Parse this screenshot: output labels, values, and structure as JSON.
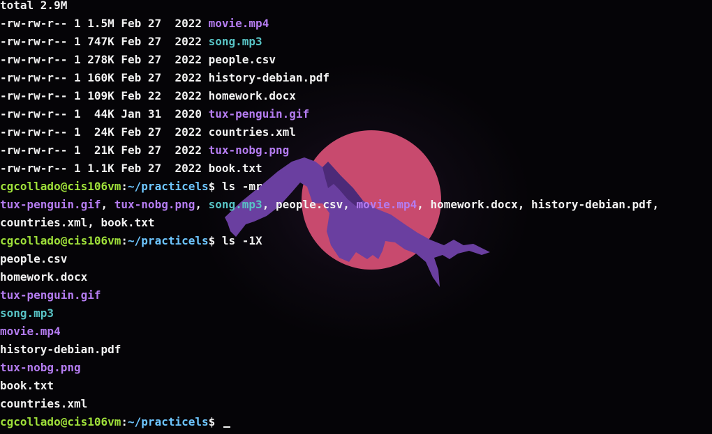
{
  "terminal": {
    "lines": [
      [
        {
          "t": "total 2.9M",
          "c": "normal"
        }
      ],
      [
        {
          "t": "-rw-rw-r-- 1 1.5M Feb 27  2022 ",
          "c": "normal"
        },
        {
          "t": "movie.mp4",
          "c": "media"
        }
      ],
      [
        {
          "t": "-rw-rw-r-- 1 747K Feb 27  2022 ",
          "c": "normal"
        },
        {
          "t": "song.mp3",
          "c": "audio"
        }
      ],
      [
        {
          "t": "-rw-rw-r-- 1 278K Feb 27  2022 ",
          "c": "normal"
        },
        {
          "t": "people.csv",
          "c": "normal"
        }
      ],
      [
        {
          "t": "-rw-rw-r-- 1 160K Feb 27  2022 ",
          "c": "normal"
        },
        {
          "t": "history-debian.pdf",
          "c": "normal"
        }
      ],
      [
        {
          "t": "-rw-rw-r-- 1 109K Feb 22  2022 ",
          "c": "normal"
        },
        {
          "t": "homework.docx",
          "c": "normal"
        }
      ],
      [
        {
          "t": "-rw-rw-r-- 1  44K Jan 31  2020 ",
          "c": "normal"
        },
        {
          "t": "tux-penguin.gif",
          "c": "media"
        }
      ],
      [
        {
          "t": "-rw-rw-r-- 1  24K Feb 27  2022 ",
          "c": "normal"
        },
        {
          "t": "countries.xml",
          "c": "normal"
        }
      ],
      [
        {
          "t": "-rw-rw-r-- 1  21K Feb 27  2022 ",
          "c": "normal"
        },
        {
          "t": "tux-nobg.png",
          "c": "media"
        }
      ],
      [
        {
          "t": "-rw-rw-r-- 1 1.1K Feb 27  2022 ",
          "c": "normal"
        },
        {
          "t": "book.txt",
          "c": "normal"
        }
      ],
      [
        {
          "t": "cgcollado@cis106vm",
          "c": "user"
        },
        {
          "t": ":",
          "c": "sep"
        },
        {
          "t": "~/practicels",
          "c": "path"
        },
        {
          "t": "$ ls -mr",
          "c": "normal"
        }
      ],
      [
        {
          "t": "tux-penguin.gif",
          "c": "media"
        },
        {
          "t": ", ",
          "c": "normal"
        },
        {
          "t": "tux-nobg.png",
          "c": "media"
        },
        {
          "t": ", ",
          "c": "normal"
        },
        {
          "t": "song.mp3",
          "c": "audio"
        },
        {
          "t": ", people.csv, ",
          "c": "normal"
        },
        {
          "t": "movie.mp4",
          "c": "media"
        },
        {
          "t": ", homework.docx, history-debian.pdf,",
          "c": "normal"
        }
      ],
      [
        {
          "t": "countries.xml, book.txt",
          "c": "normal"
        }
      ],
      [
        {
          "t": "cgcollado@cis106vm",
          "c": "user"
        },
        {
          "t": ":",
          "c": "sep"
        },
        {
          "t": "~/practicels",
          "c": "path"
        },
        {
          "t": "$ ls -1X",
          "c": "normal"
        }
      ],
      [
        {
          "t": "people.csv",
          "c": "normal"
        }
      ],
      [
        {
          "t": "homework.docx",
          "c": "normal"
        }
      ],
      [
        {
          "t": "tux-penguin.gif",
          "c": "media"
        }
      ],
      [
        {
          "t": "song.mp3",
          "c": "audio"
        }
      ],
      [
        {
          "t": "movie.mp4",
          "c": "media"
        }
      ],
      [
        {
          "t": "history-debian.pdf",
          "c": "normal"
        }
      ],
      [
        {
          "t": "tux-nobg.png",
          "c": "media"
        }
      ],
      [
        {
          "t": "book.txt",
          "c": "normal"
        }
      ],
      [
        {
          "t": "countries.xml",
          "c": "normal"
        }
      ],
      [
        {
          "t": "cgcollado@cis106vm",
          "c": "user"
        },
        {
          "t": ":",
          "c": "sep"
        },
        {
          "t": "~/practicels",
          "c": "path"
        },
        {
          "t": "$ ",
          "c": "normal"
        }
      ]
    ],
    "cursor_line": 23
  },
  "wallpaper": {
    "icon": "sun-mountain-logo-icon",
    "colors": {
      "sun": "#c84a6e",
      "mountain": "#6a3fa0",
      "mountain_shadow": "#4c2a78",
      "background": "#050407"
    }
  },
  "colors": {
    "normal_text": "#f2f2f2",
    "media_file": "#b47cf0",
    "audio_file": "#58c3c5",
    "prompt_user": "#9fe03a",
    "prompt_path": "#6ec6ff"
  }
}
